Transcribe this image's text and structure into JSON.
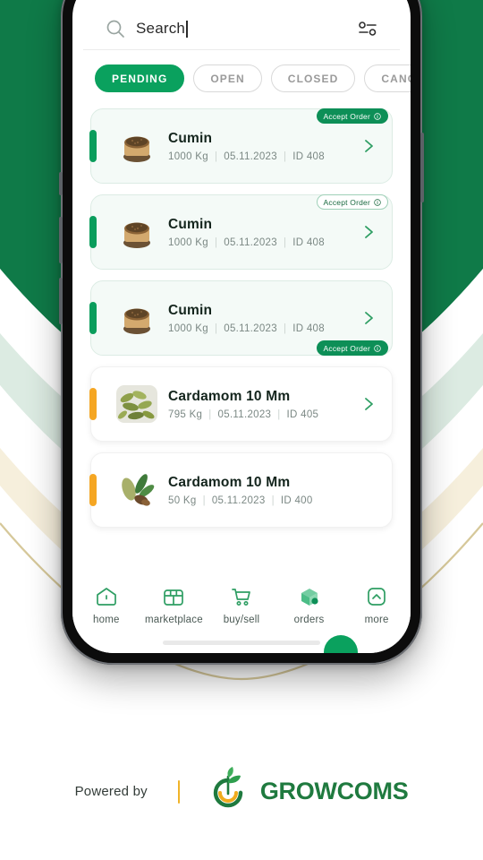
{
  "search": {
    "value": "Search",
    "icon": "search-icon",
    "filter_icon": "filter-sliders-icon"
  },
  "filters": [
    {
      "label": "PENDING",
      "active": true
    },
    {
      "label": "OPEN",
      "active": false
    },
    {
      "label": "CLOSED",
      "active": false
    },
    {
      "label": "CANCELLED",
      "active": false
    }
  ],
  "orders": [
    {
      "name": "Cumin",
      "quantity": "1000 Kg",
      "date": "05.11.2023",
      "id": "ID 408",
      "accent": "green",
      "card_style": "tint",
      "badge": {
        "label": "Accept Order",
        "style": "filled",
        "position": "top",
        "icon": "info-icon"
      },
      "chevron": true,
      "thumb": "cumin-bowl-image"
    },
    {
      "name": "Cumin",
      "quantity": "1000 Kg",
      "date": "05.11.2023",
      "id": "ID 408",
      "accent": "green",
      "card_style": "tint",
      "badge": {
        "label": "Accept Order",
        "style": "outline",
        "position": "top",
        "icon": "info-icon"
      },
      "chevron": true,
      "thumb": "cumin-bowl-image"
    },
    {
      "name": "Cumin",
      "quantity": "1000 Kg",
      "date": "05.11.2023",
      "id": "ID 408",
      "accent": "green",
      "card_style": "tint",
      "badge": {
        "label": "Accept Order",
        "style": "filled",
        "position": "bottom",
        "icon": "info-icon"
      },
      "chevron": true,
      "thumb": "cumin-bowl-image"
    },
    {
      "name": "Cardamom 10 Mm",
      "quantity": "795 Kg",
      "date": "05.11.2023",
      "id": "ID 405",
      "accent": "amber",
      "card_style": "plain",
      "badge": null,
      "chevron": true,
      "thumb": "cardamom-pods-image"
    },
    {
      "name": "Cardamom 10 Mm",
      "quantity": "50 Kg",
      "date": "05.11.2023",
      "id": "ID 400",
      "accent": "amber",
      "card_style": "plain",
      "badge": null,
      "chevron": false,
      "thumb": "cardamom-leaf-image"
    }
  ],
  "separator": "|",
  "nav": [
    {
      "label": "home",
      "icon": "home-icon",
      "active": false
    },
    {
      "label": "marketplace",
      "icon": "store-icon",
      "active": false
    },
    {
      "label": "buy/sell",
      "icon": "cart-icon",
      "active": false
    },
    {
      "label": "orders",
      "icon": "cube-box-icon",
      "active": true
    },
    {
      "label": "more",
      "icon": "chevron-up-square-icon",
      "active": false
    }
  ],
  "footer": {
    "powered_by": "Powered by",
    "brand": "GROWCOMS",
    "logo_icon": "growcoms-leaf-logo"
  },
  "colors": {
    "primary_green": "#0aa15e",
    "dark_green": "#0d7a47",
    "amber": "#f5a623",
    "card_tint": "#f4faf7",
    "brand_green": "#1f7a3f"
  }
}
